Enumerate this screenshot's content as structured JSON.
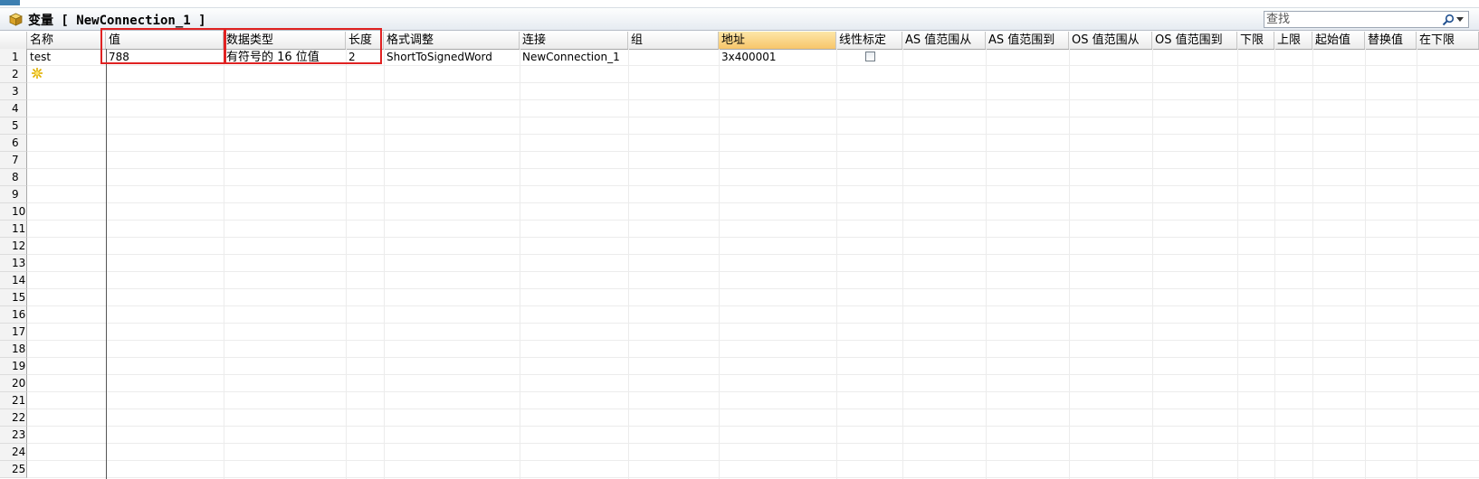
{
  "window": {
    "title": "变量 [ NewConnection_1 ]"
  },
  "search": {
    "placeholder": "查找"
  },
  "columns": [
    "名称",
    "值",
    "数据类型",
    "长度",
    "格式调整",
    "连接",
    "组",
    "地址",
    "线性标定",
    "AS 值范围从",
    "AS 值范围到",
    "OS 值范围从",
    "OS 值范围到",
    "下限",
    "上限",
    "起始值",
    "替换值",
    "在下限"
  ],
  "highlighted_column": "地址",
  "rows": [
    {
      "num": "1",
      "name": "test",
      "value": "788",
      "data_type": "有符号的 16 位值",
      "length": "2",
      "format": "ShortToSignedWord",
      "connection": "NewConnection_1",
      "group": "",
      "address": "3x400001",
      "linear_scaling": false
    }
  ],
  "row_numbers": [
    "1",
    "2",
    "3",
    "4",
    "5",
    "6",
    "7",
    "8",
    "9",
    "10",
    "11",
    "12",
    "13",
    "14",
    "15",
    "16",
    "17",
    "18",
    "19",
    "20",
    "21",
    "22",
    "23",
    "24",
    "25"
  ],
  "icons": {
    "title": "cube-icon",
    "search": "search-icon",
    "new_row": "new-row-star-icon"
  },
  "colors": {
    "highlight_header": "#f7c56a",
    "annotation_box": "#e02222"
  }
}
